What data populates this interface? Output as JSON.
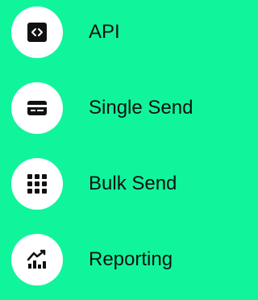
{
  "menu": {
    "items": [
      {
        "label": "API",
        "icon": "code-icon"
      },
      {
        "label": "Single Send",
        "icon": "card-icon"
      },
      {
        "label": "Bulk Send",
        "icon": "grid-icon"
      },
      {
        "label": "Reporting",
        "icon": "chart-icon"
      }
    ]
  },
  "colors": {
    "background": "#10F59C",
    "circle": "#FFFFFF",
    "icon": "#111111",
    "text": "#111111"
  }
}
